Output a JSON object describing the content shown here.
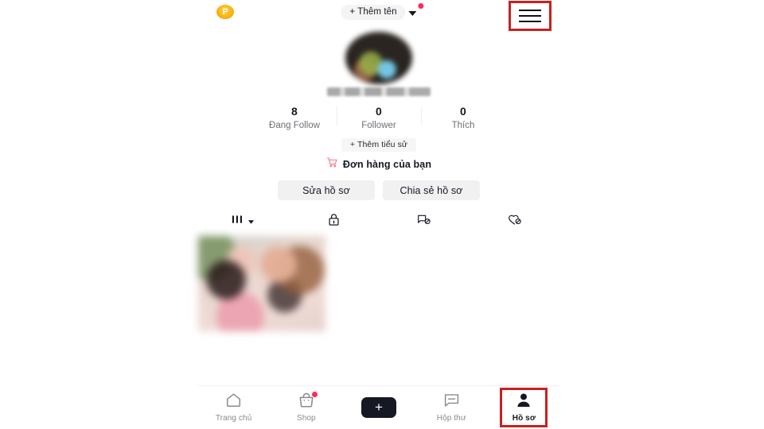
{
  "app": {
    "platform_accent_cyan": "#25f4ee",
    "platform_accent_pink": "#fe2c55",
    "annotation_box_color": "#cc1f1f",
    "background": "#ffffff"
  },
  "topbar": {
    "points_badge": {
      "icon": "p-coin-icon",
      "label": "P"
    },
    "add_name_chip": {
      "label": "+ Thêm tên",
      "icon": "chevron-down-icon",
      "has_notification_dot": true
    },
    "menu": {
      "icon": "hamburger-menu-icon",
      "annotated": true
    }
  },
  "profile": {
    "avatar": {
      "icon": "avatar-image",
      "blurred": true
    },
    "username": {
      "value": "",
      "blurred": true
    },
    "stats": [
      {
        "count": "8",
        "label": "Đang Follow",
        "name": "following"
      },
      {
        "count": "0",
        "label": "Follower",
        "name": "followers"
      },
      {
        "count": "0",
        "label": "Thích",
        "name": "likes"
      }
    ],
    "bio_chip": {
      "label": "+ Thêm tiểu sử"
    },
    "orders_link": {
      "icon": "shopping-cart-icon",
      "label": "Đơn hàng của bạn"
    },
    "actions": [
      {
        "label": "Sửa hồ sơ",
        "name": "edit-profile-button"
      },
      {
        "label": "Chia sẻ hồ sơ",
        "name": "share-profile-button"
      }
    ]
  },
  "content_tabs": [
    {
      "name": "tab-posts",
      "icon": "grid-bars-icon",
      "has_chevron": true,
      "active": true
    },
    {
      "name": "tab-private",
      "icon": "lock-icon",
      "active": false
    },
    {
      "name": "tab-reposts",
      "icon": "repost-crossed-icon",
      "active": false
    },
    {
      "name": "tab-liked",
      "icon": "heart-crossed-icon",
      "active": false
    }
  ],
  "posts": [
    {
      "name": "post-thumbnail",
      "blurred": true
    }
  ],
  "bottom_nav": [
    {
      "label": "Trang chủ",
      "icon": "home-icon",
      "name": "nav-home",
      "active": false,
      "badge": false
    },
    {
      "label": "Shop",
      "icon": "shop-bag-icon",
      "name": "nav-shop",
      "active": false,
      "badge": true
    },
    {
      "label": "",
      "icon": "plus-create-icon",
      "name": "nav-create",
      "active": false,
      "badge": false
    },
    {
      "label": "Hộp thư",
      "icon": "inbox-message-icon",
      "name": "nav-inbox",
      "active": false,
      "badge": false
    },
    {
      "label": "Hồ sơ",
      "icon": "person-icon",
      "name": "nav-profile",
      "active": true,
      "badge": false
    }
  ]
}
